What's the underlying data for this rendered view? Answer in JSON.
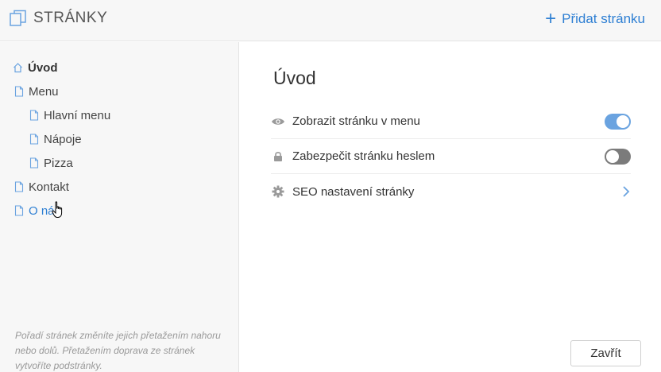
{
  "header": {
    "title": "STRÁNKY",
    "add_page_label": "Přidat stránku"
  },
  "sidebar": {
    "items": [
      {
        "label": "Úvod",
        "icon": "home-icon"
      },
      {
        "label": "Menu",
        "icon": "page-icon"
      },
      {
        "label": "Hlavní menu",
        "icon": "page-icon"
      },
      {
        "label": "Nápoje",
        "icon": "page-icon"
      },
      {
        "label": "Pizza",
        "icon": "page-icon"
      },
      {
        "label": "Kontakt",
        "icon": "page-icon"
      },
      {
        "label": "O nás",
        "icon": "page-icon"
      }
    ],
    "hint": "Pořadí stránek změníte jejich přetažením nahoru nebo dolů. Přetažením doprava ze stránek vytvoříte podstránky."
  },
  "main": {
    "heading": "Úvod",
    "settings": [
      {
        "label": "Zobrazit stránku v menu",
        "icon": "eye-icon",
        "control": "toggle",
        "state": "on"
      },
      {
        "label": "Zabezpečit stránku heslem",
        "icon": "lock-icon",
        "control": "toggle",
        "state": "off"
      },
      {
        "label": "SEO nastavení stránky",
        "icon": "gear-icon",
        "control": "chevron"
      }
    ],
    "close_label": "Zavřít"
  },
  "colors": {
    "accent": "#2e7fd3",
    "toggle_on": "#6aa3e0",
    "toggle_off": "#7b7b7b",
    "sidebar_bg": "#f7f7f7"
  }
}
